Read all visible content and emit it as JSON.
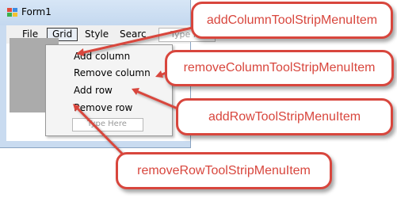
{
  "window": {
    "title": "Form1",
    "icon": "winforms-app-icon"
  },
  "menubar": {
    "items": [
      "File",
      "Grid",
      "Style",
      "Search"
    ],
    "type_here": "Type Here"
  },
  "grid_menu": {
    "items": [
      "Add column",
      "Remove column",
      "Add row",
      "Remove row"
    ],
    "type_here": "Type Here"
  },
  "callouts": {
    "add_column": "addColumnToolStripMenuItem",
    "remove_column": "removeColumnToolStripMenuItem",
    "add_row": "addRowToolStripMenuItem",
    "remove_row": "removeRowToolStripMenuItem"
  },
  "colors": {
    "callout": "#d8463d",
    "titlebar": "#c9dbf0",
    "menu_background": "#f4f4f4"
  }
}
